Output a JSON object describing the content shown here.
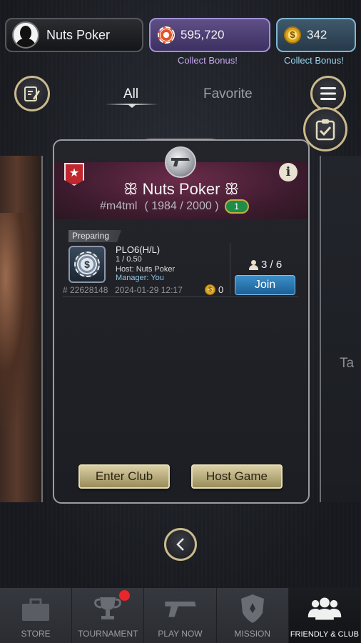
{
  "profile": {
    "name": "Nuts Poker"
  },
  "currency": {
    "chips": "595,720",
    "coins": "342",
    "chips_collect": "Collect Bonus!",
    "coins_collect": "Collect Bonus!"
  },
  "tabs": [
    {
      "label": "All",
      "active": true
    },
    {
      "label": "Favorite",
      "active": false
    }
  ],
  "side_right_text": "Ta",
  "club": {
    "name": "ꕥ Nuts Poker ꕥ",
    "id": "#m4tml",
    "members": "( 1984 / 2000 )",
    "level": "1"
  },
  "game": {
    "status": "Preparing",
    "title": "PLO6(H/L)",
    "blinds": "1 / 0.50",
    "host": "Host: Nuts Poker",
    "manager": "Manager: You",
    "game_id": "# 22628148",
    "date": "2024-01-29 12:17",
    "fee": "0",
    "seats": "3 / 6",
    "join_label": "Join"
  },
  "actions": {
    "enter_club": "Enter Club",
    "host_game": "Host Game"
  },
  "nav": [
    {
      "label": "STORE",
      "icon": "store-icon",
      "active": false
    },
    {
      "label": "TOURNAMENT",
      "icon": "trophy-icon",
      "active": false,
      "notify": true
    },
    {
      "label": "PLAY NOW",
      "icon": "gun-icon",
      "active": false
    },
    {
      "label": "MISSION",
      "icon": "badge-icon",
      "active": false
    },
    {
      "label": "FRIENDLY & CLUB",
      "icon": "group-icon",
      "active": true
    }
  ],
  "colors": {
    "chips_accent": "#a28fd8",
    "coins_accent": "#7fb6d2",
    "join_button": "#2a78b4",
    "gold_button": "#c8bd8e",
    "notify": "#e8262c"
  }
}
